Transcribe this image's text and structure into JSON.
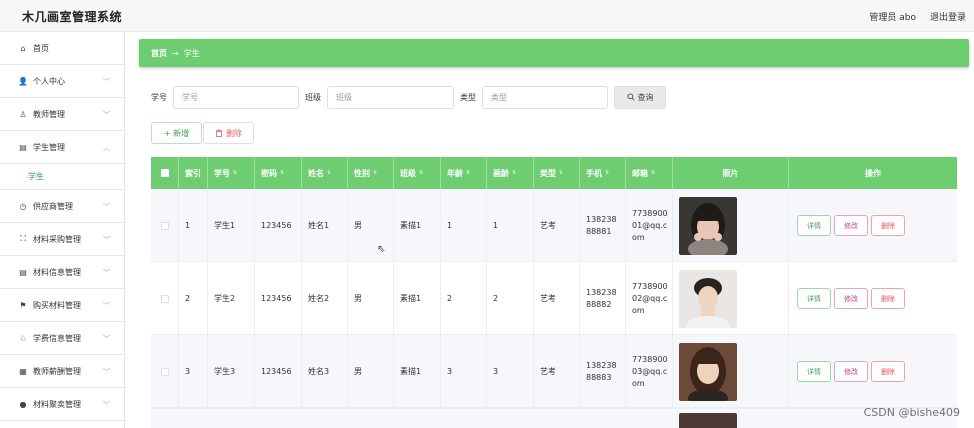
{
  "app": {
    "title": "木几画室管理系统",
    "admin": "管理员 abo",
    "logout": "退出登录"
  },
  "sidebar": {
    "items": [
      {
        "label": "首页",
        "icon": "home-icon",
        "glyph": "⌂",
        "chevron": false
      },
      {
        "label": "个人中心",
        "icon": "user-icon",
        "glyph": "👤",
        "chevron": true
      },
      {
        "label": "教师管理",
        "icon": "teacher-icon",
        "glyph": "♙",
        "chevron": true
      },
      {
        "label": "学生管理",
        "icon": "clipboard-icon",
        "glyph": "▤",
        "chevron": true,
        "expanded": true
      },
      {
        "label": "供应商管理",
        "icon": "clock-icon",
        "glyph": "◷",
        "chevron": true
      },
      {
        "label": "材料采购管理",
        "icon": "frame-icon",
        "glyph": "⛶",
        "chevron": true
      },
      {
        "label": "材料信息管理",
        "icon": "doc-icon",
        "glyph": "▤",
        "chevron": true
      },
      {
        "label": "购买材料管理",
        "icon": "flag-icon",
        "glyph": "⚑",
        "chevron": true
      },
      {
        "label": "学费信息管理",
        "icon": "stamp-icon",
        "glyph": "♘",
        "chevron": true
      },
      {
        "label": "教师薪酬管理",
        "icon": "grid-icon",
        "glyph": "▦",
        "chevron": true
      },
      {
        "label": "材料聚卖管理",
        "icon": "pin-icon",
        "glyph": "●",
        "chevron": true
      }
    ],
    "sub_item": "学生"
  },
  "breadcrumb": {
    "home": "首页",
    "arrow": "→",
    "current": "学生"
  },
  "search": {
    "fields": [
      {
        "label": "学号",
        "placeholder": "学号"
      },
      {
        "label": "班级",
        "placeholder": "班级"
      },
      {
        "label": "类型",
        "placeholder": "类型"
      }
    ],
    "button": "查询",
    "button_icon": "search-icon"
  },
  "actions": {
    "add": "+ 新增",
    "delete": "删除"
  },
  "table": {
    "columns": [
      "索引",
      "学号",
      "密码",
      "姓名",
      "性别",
      "班级",
      "年龄",
      "画龄",
      "类型",
      "手机",
      "邮箱",
      "照片",
      "操作"
    ],
    "sort_glyph": "⇅",
    "rows": [
      {
        "index": "1",
        "student_id": "学生1",
        "password": "123456",
        "name": "姓名1",
        "gender": "男",
        "class": "素描1",
        "age": "1",
        "years": "1",
        "type": "艺考",
        "phone": "13823888881",
        "email": "773890001@qq.com"
      },
      {
        "index": "2",
        "student_id": "学生2",
        "password": "123456",
        "name": "姓名2",
        "gender": "男",
        "class": "素描1",
        "age": "2",
        "years": "2",
        "type": "艺考",
        "phone": "13823888882",
        "email": "773890002@qq.com"
      },
      {
        "index": "3",
        "student_id": "学生3",
        "password": "123456",
        "name": "姓名3",
        "gender": "男",
        "class": "素描1",
        "age": "3",
        "years": "3",
        "type": "艺考",
        "phone": "13823888883",
        "email": "773890003@qq.com"
      }
    ],
    "ops": {
      "detail": "详情",
      "edit": "修改",
      "remove": "删除"
    }
  },
  "watermark": "CSDN @bishe409",
  "colors": {
    "accent": "#6ecd70",
    "header_bg": "#f7f7f7",
    "sub_active": "#2e9d4f"
  }
}
